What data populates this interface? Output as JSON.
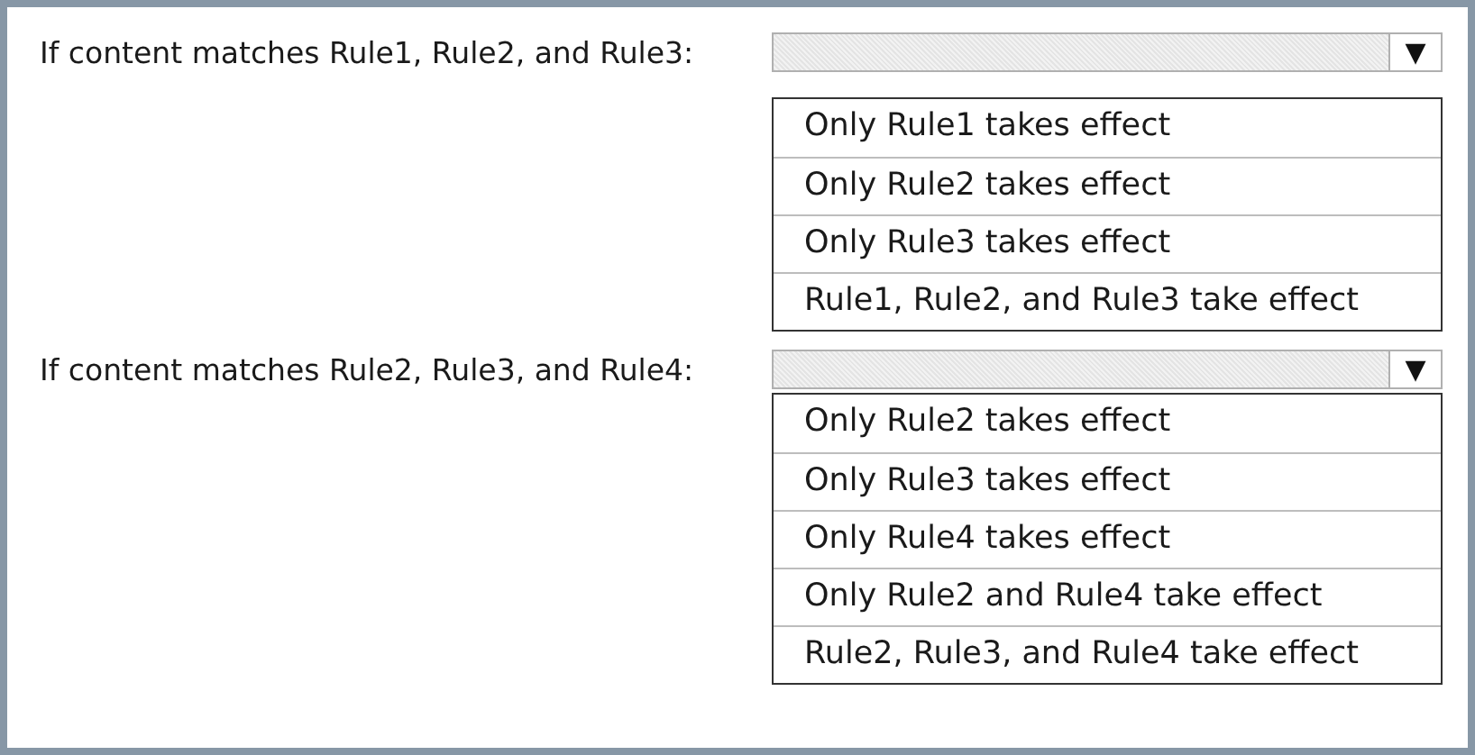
{
  "questions": [
    {
      "label": "If content matches Rule1, Rule2, and Rule3:",
      "arrow": "▼",
      "options": [
        "Only Rule1 takes effect",
        "Only Rule2 takes effect",
        "Only Rule3 takes effect",
        "Rule1, Rule2, and Rule3 take effect"
      ]
    },
    {
      "label": "If content matches Rule2, Rule3, and Rule4:",
      "arrow": "▼",
      "options": [
        "Only Rule2 takes effect",
        "Only Rule3 takes effect",
        "Only Rule4 takes effect",
        "Only Rule2 and Rule4 take effect",
        "Rule2, Rule3, and Rule4 take effect"
      ]
    }
  ]
}
